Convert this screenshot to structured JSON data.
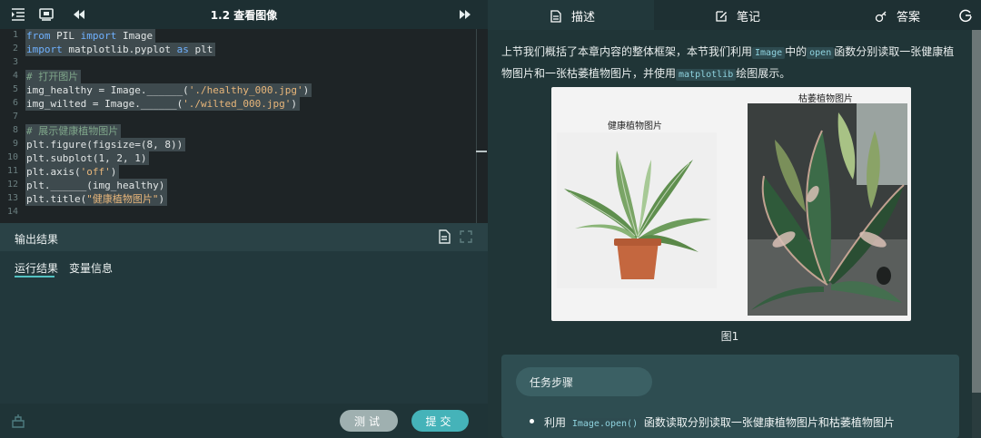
{
  "toolbar": {
    "file_title": "1.2 查看图像"
  },
  "editor": {
    "line_numbers": [
      "1",
      "2",
      "3",
      "4",
      "5",
      "6",
      "7",
      "8",
      "9",
      "10",
      "11",
      "12",
      "13",
      "14"
    ],
    "lines": [
      {
        "parts": [
          {
            "t": "from ",
            "c": "kw"
          },
          {
            "t": "PIL ",
            "c": ""
          },
          {
            "t": "import ",
            "c": "kw"
          },
          {
            "t": "Image",
            "c": ""
          }
        ],
        "selected": true
      },
      {
        "parts": [
          {
            "t": "import ",
            "c": "kw"
          },
          {
            "t": "matplotlib.pyplot ",
            "c": ""
          },
          {
            "t": "as ",
            "c": "kw"
          },
          {
            "t": "plt",
            "c": ""
          }
        ],
        "selected": true
      },
      {
        "parts": [],
        "selected": false
      },
      {
        "parts": [
          {
            "t": "# 打开图片",
            "c": "cm"
          }
        ],
        "selected": true
      },
      {
        "parts": [
          {
            "t": "img_healthy = Image.______(",
            "c": ""
          },
          {
            "t": "'./healthy_000.jpg'",
            "c": "st"
          },
          {
            "t": ")",
            "c": ""
          }
        ],
        "selected": true
      },
      {
        "parts": [
          {
            "t": "img_wilted = Image.______(",
            "c": ""
          },
          {
            "t": "'./wilted_000.jpg'",
            "c": "st"
          },
          {
            "t": ")",
            "c": ""
          }
        ],
        "selected": true
      },
      {
        "parts": [],
        "selected": false
      },
      {
        "parts": [
          {
            "t": "# 展示健康植物图片",
            "c": "cm"
          }
        ],
        "selected": true
      },
      {
        "parts": [
          {
            "t": "plt.figure(figsize=(8, 8))",
            "c": ""
          }
        ],
        "selected": true
      },
      {
        "parts": [
          {
            "t": "plt.subplot(1, 2, 1)",
            "c": ""
          }
        ],
        "selected": true
      },
      {
        "parts": [
          {
            "t": "plt.axis(",
            "c": ""
          },
          {
            "t": "'off'",
            "c": "st"
          },
          {
            "t": ")",
            "c": ""
          }
        ],
        "selected": true
      },
      {
        "parts": [
          {
            "t": "plt.______(img_healthy)",
            "c": ""
          }
        ],
        "selected": true
      },
      {
        "parts": [
          {
            "t": "plt.title(",
            "c": ""
          },
          {
            "t": "\"健康植物图片\"",
            "c": "st"
          },
          {
            "t": ")",
            "c": ""
          }
        ],
        "selected": true
      },
      {
        "parts": [],
        "selected": false
      }
    ]
  },
  "output": {
    "title": "输出结果",
    "tabs": [
      "运行结果",
      "变量信息"
    ]
  },
  "actions": {
    "test_label": "测试",
    "submit_label": "提交"
  },
  "right_tabs": {
    "describe": "描述",
    "notes": "笔记",
    "answer": "答案"
  },
  "content": {
    "intro_1": "上节我们概括了本章内容的整体框架，本节我们利用",
    "intro_code_1": "Image",
    "intro_2": "中的",
    "intro_code_2": "open",
    "intro_3": "函数分别读取一张健康植物图片和一张枯萎植物图片，并使用",
    "intro_code_3": "matplotlib",
    "intro_4": "绘图展示。",
    "figure_caption_left": "健康植物图片",
    "figure_caption_right": "枯萎植物图片",
    "figure_label": "图1",
    "task_title": "任务步骤",
    "task_item_1": "利用",
    "task_item_code": "Image.open()",
    "task_item_2": "函数读取分别读取一张健康植物图片和枯萎植物图片"
  },
  "colors": {
    "accent": "#45b3b9",
    "tab_underline": "#53c2c2",
    "keyword": "#6fb1ff",
    "string": "#e8b67a",
    "comment": "#7fa68a"
  }
}
